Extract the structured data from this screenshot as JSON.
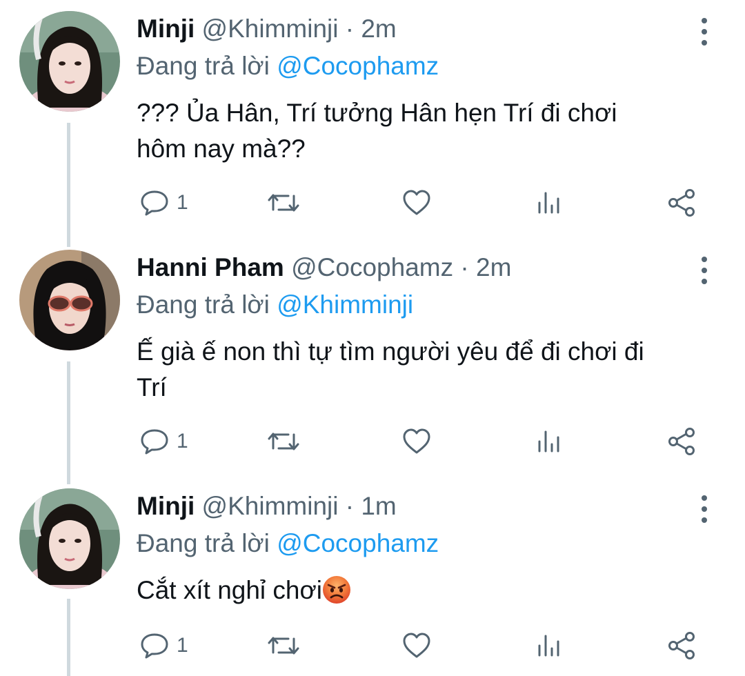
{
  "colors": {
    "mention": "#1d9bf0",
    "secondary_text": "#536471",
    "thread_line": "#cfd9de"
  },
  "tweets": [
    {
      "name": "Minji",
      "handle": "@Khimminji",
      "separator": "·",
      "time": "2m",
      "reply_prefix": "Đang trả lời",
      "reply_to": "@Cocophamz",
      "text_line1": "??? Ủa Hân, Trí tưởng Hân hẹn Trí đi chơi",
      "text_line2": "hôm nay mà??",
      "reply_count": "1",
      "icons": [
        "reply-icon",
        "retweet-icon",
        "like-icon",
        "analytics-icon",
        "share-icon",
        "more-icon"
      ]
    },
    {
      "name": "Hanni Pham",
      "handle": "@Cocophamz",
      "separator": "·",
      "time": "2m",
      "reply_prefix": "Đang trả lời",
      "reply_to": "@Khimminji",
      "text_line1": "Ế già ế non thì tự tìm người yêu để đi chơi đi",
      "text_line2": "Trí",
      "reply_count": "1",
      "icons": [
        "reply-icon",
        "retweet-icon",
        "like-icon",
        "analytics-icon",
        "share-icon",
        "more-icon"
      ]
    },
    {
      "name": "Minji",
      "handle": "@Khimminji",
      "separator": "·",
      "time": "1m",
      "reply_prefix": "Đang trả lời",
      "reply_to": "@Cocophamz",
      "text_line1": "Cắt xít nghỉ chơi",
      "text_emoji": "angry-face-emoji",
      "reply_count": "1",
      "icons": [
        "reply-icon",
        "retweet-icon",
        "like-icon",
        "analytics-icon",
        "share-icon",
        "more-icon"
      ]
    }
  ]
}
